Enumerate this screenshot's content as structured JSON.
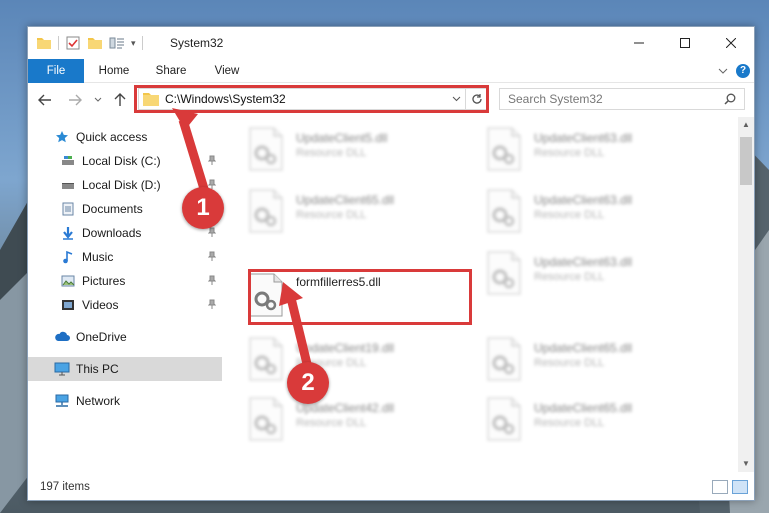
{
  "window": {
    "title": "System32",
    "qat_dropdown": "▾"
  },
  "ribbon": {
    "tabs": [
      {
        "label": "File"
      },
      {
        "label": "Home"
      },
      {
        "label": "Share"
      },
      {
        "label": "View"
      }
    ]
  },
  "navbar": {
    "address": "C:\\Windows\\System32",
    "search_placeholder": "Search System32"
  },
  "sidebar": {
    "items": [
      {
        "label": "Quick access",
        "icon": "star-icon"
      },
      {
        "label": "Local Disk (C:)",
        "icon": "drive-icon",
        "pinned": true
      },
      {
        "label": "Local Disk (D:)",
        "icon": "drive-icon",
        "pinned": true
      },
      {
        "label": "Documents",
        "icon": "document-icon",
        "pinned": true
      },
      {
        "label": "Downloads",
        "icon": "download-icon",
        "pinned": true
      },
      {
        "label": "Music",
        "icon": "music-icon",
        "pinned": true
      },
      {
        "label": "Pictures",
        "icon": "pictures-icon",
        "pinned": true
      },
      {
        "label": "Videos",
        "icon": "video-icon",
        "pinned": true
      },
      {
        "label": "OneDrive",
        "icon": "cloud-icon"
      },
      {
        "label": "This PC",
        "icon": "computer-icon",
        "selected": true
      },
      {
        "label": "Network",
        "icon": "network-icon"
      }
    ]
  },
  "files": [
    {
      "name": "UpdateClient5.dll",
      "desc": "Resource DLL",
      "blurred": true
    },
    {
      "name": "UpdateClient63.dll",
      "desc": "Resource DLL",
      "blurred": true
    },
    {
      "name": "UpdateClient65.dll",
      "desc": "Resource DLL",
      "blurred": true
    },
    {
      "name": "UpdateClient63.dll",
      "desc": "Resource DLL",
      "blurred": true
    },
    {
      "name": "formfillerres5.dll",
      "desc": "",
      "blurred": false
    },
    {
      "name": "UpdateClient63.dll",
      "desc": "Resource DLL",
      "blurred": true
    },
    {
      "name": "UpdateClient19.dll",
      "desc": "Resource DLL",
      "blurred": true
    },
    {
      "name": "UpdateClient65.dll",
      "desc": "Resource DLL",
      "blurred": true
    },
    {
      "name": "UpdateClient42.dll",
      "desc": "Resource DLL",
      "blurred": true
    },
    {
      "name": "UpdateClient65.dll",
      "desc": "Resource DLL",
      "blurred": true
    }
  ],
  "status": {
    "item_count": "197 items"
  },
  "annotations": {
    "step1": "1",
    "step2": "2",
    "color": "#d93a3a"
  },
  "colors": {
    "accent": "#1979ca",
    "highlight": "#d93a3a",
    "selected_bg": "#d9d9d9"
  }
}
